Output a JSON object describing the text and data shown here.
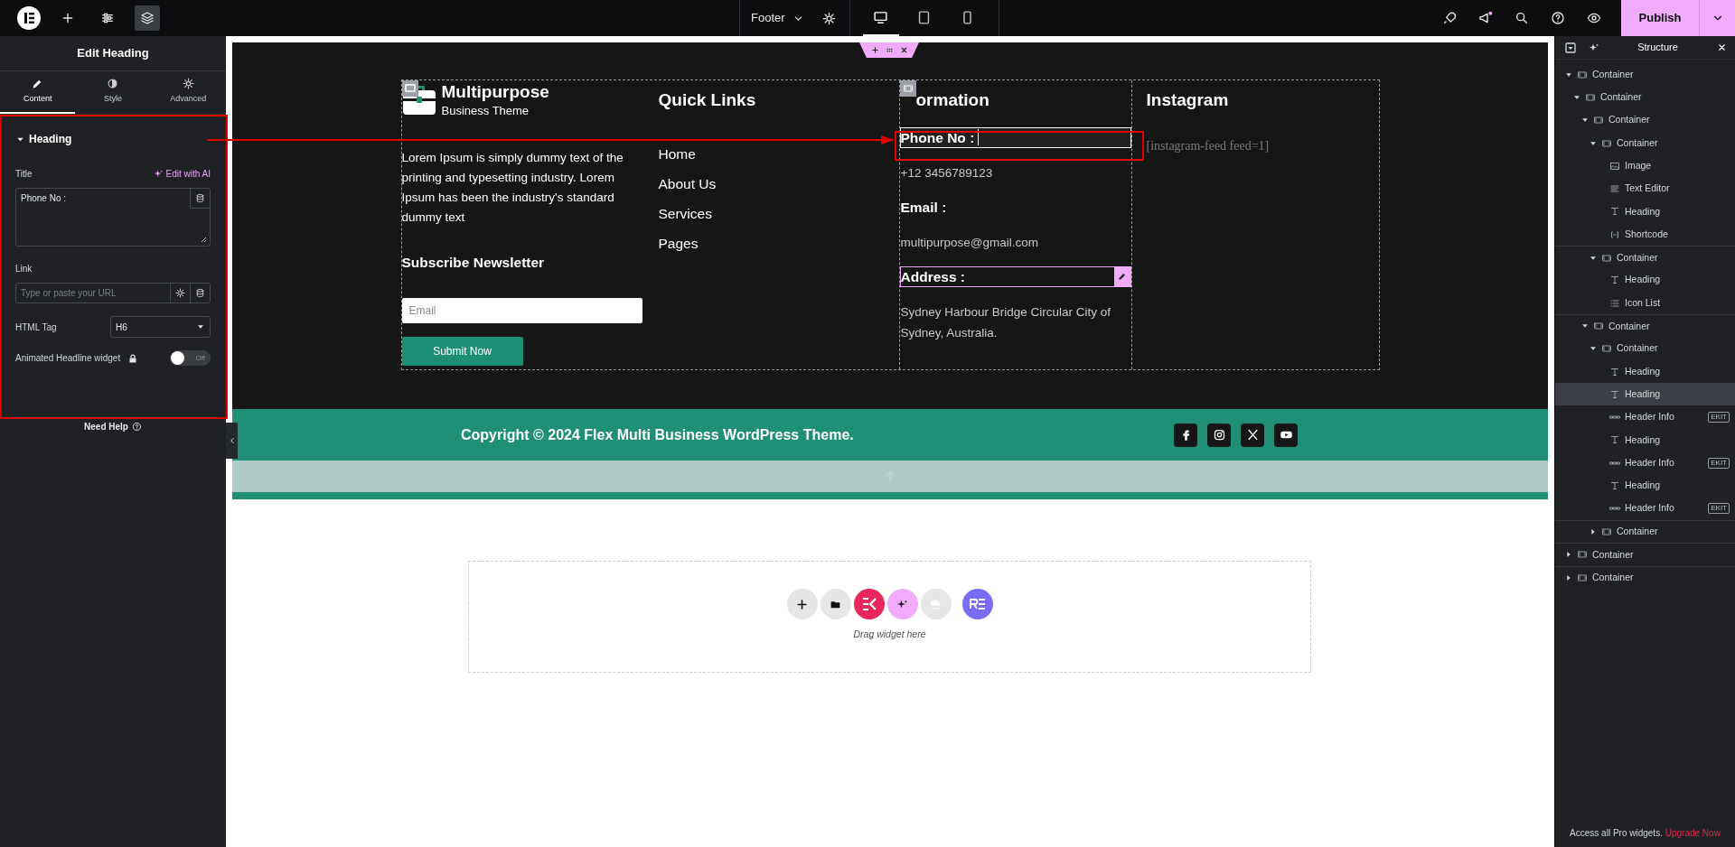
{
  "topbar": {
    "document": "Footer",
    "devices": [
      {
        "kind": "desktop",
        "selected": true
      },
      {
        "kind": "tablet",
        "selected": false
      },
      {
        "kind": "mobile",
        "selected": false
      }
    ],
    "publish": "Publish"
  },
  "panel": {
    "title": "Edit Heading",
    "tabs": [
      {
        "kind": "content",
        "label": "Content",
        "selected": true
      },
      {
        "kind": "style",
        "label": "Style",
        "selected": false
      },
      {
        "kind": "advanced",
        "label": "Advanced",
        "selected": false
      }
    ],
    "section": {
      "label": "Heading",
      "expanded": true
    },
    "fields": {
      "title_label": "Title",
      "ai_link": "Edit with AI",
      "title_value": "Phone No :",
      "link_label": "Link",
      "link_placeholder": "Type or paste your URL",
      "tag_label": "HTML Tag",
      "tag_value": "H6",
      "animated_label": "Animated Headline widget",
      "animated_toggle": {
        "on": false,
        "label": "Off"
      }
    },
    "help": "Need Help"
  },
  "canvas": {
    "brand": {
      "title": "Multipurpose",
      "subtitle": "Business Theme"
    },
    "about": "Lorem Ipsum is simply dummy text of the printing and typesetting industry. Lorem Ipsum has been the industry's standard dummy text",
    "newsletter": {
      "heading": "Subscribe Newsletter",
      "placeholder": "Email",
      "button": "Submit Now"
    },
    "quick_links": {
      "heading": "Quick Links",
      "links": [
        "Home",
        "About Us",
        "Services",
        "Pages"
      ]
    },
    "information": {
      "heading": "ormation",
      "items": [
        {
          "kind": "heading",
          "text": "Phone No :",
          "selected": true,
          "hovered": false
        },
        {
          "kind": "text",
          "text": "+12 3456789123",
          "selected": false,
          "hovered": false
        },
        {
          "kind": "heading",
          "text": "Email :",
          "selected": false,
          "hovered": false
        },
        {
          "kind": "text",
          "text": "multipurpose@gmail.com",
          "selected": false,
          "hovered": false
        },
        {
          "kind": "heading",
          "text": "Address :",
          "selected": false,
          "hovered": true
        },
        {
          "kind": "text",
          "text": "Sydney Harbour Bridge Circular City of Sydney, Australia.",
          "selected": false,
          "hovered": false
        }
      ]
    },
    "instagram": {
      "heading": "Instagram",
      "shortcode": "[instagram-feed feed=1]"
    },
    "copyright": "Copyright © 2024 Flex Multi Business WordPress Theme.",
    "socials": [
      {
        "kind": "facebook"
      },
      {
        "kind": "instagram"
      },
      {
        "kind": "x"
      },
      {
        "kind": "youtube"
      }
    ],
    "drop_zone": {
      "hint": "Drag widget here"
    }
  },
  "structure": {
    "title": "Structure",
    "tree": [
      {
        "kind": "container",
        "label": "Container",
        "expanded": true,
        "selected": false,
        "children": [
          {
            "kind": "container",
            "label": "Container",
            "expanded": true,
            "selected": false,
            "children": [
              {
                "kind": "container",
                "label": "Container",
                "expanded": true,
                "selected": false,
                "children": [
                  {
                    "kind": "container",
                    "label": "Container",
                    "expanded": true,
                    "selected": false,
                    "children": [
                      {
                        "kind": "image",
                        "label": "Image",
                        "selected": false
                      },
                      {
                        "kind": "text-editor",
                        "label": "Text Editor",
                        "selected": false
                      },
                      {
                        "kind": "heading",
                        "label": "Heading",
                        "selected": false
                      },
                      {
                        "kind": "shortcode",
                        "label": "Shortcode",
                        "selected": false
                      }
                    ]
                  },
                  {
                    "kind": "container",
                    "label": "Container",
                    "expanded": true,
                    "selected": false,
                    "children": [
                      {
                        "kind": "heading",
                        "label": "Heading",
                        "selected": false
                      },
                      {
                        "kind": "icon-list",
                        "label": "Icon List",
                        "selected": false
                      }
                    ]
                  }
                ]
              },
              {
                "kind": "container",
                "label": "Container",
                "expanded": true,
                "selected": false,
                "children": [
                  {
                    "kind": "container",
                    "label": "Container",
                    "expanded": true,
                    "selected": false,
                    "children": [
                      {
                        "kind": "heading",
                        "label": "Heading",
                        "selected": false
                      },
                      {
                        "kind": "heading",
                        "label": "Heading",
                        "selected": true
                      },
                      {
                        "kind": "header-info",
                        "label": "Header Info",
                        "selected": false,
                        "badge": "EKIT"
                      },
                      {
                        "kind": "heading",
                        "label": "Heading",
                        "selected": false
                      },
                      {
                        "kind": "header-info",
                        "label": "Header Info",
                        "selected": false,
                        "badge": "EKIT"
                      },
                      {
                        "kind": "heading",
                        "label": "Heading",
                        "selected": false
                      },
                      {
                        "kind": "header-info",
                        "label": "Header Info",
                        "selected": false,
                        "badge": "EKIT"
                      }
                    ]
                  },
                  {
                    "kind": "container",
                    "label": "Container",
                    "expanded": false,
                    "selected": false
                  }
                ]
              }
            ]
          }
        ]
      },
      {
        "kind": "container",
        "label": "Container",
        "expanded": false,
        "selected": false
      },
      {
        "kind": "container",
        "label": "Container",
        "expanded": false,
        "selected": false
      }
    ],
    "footer_text": "Access all Pro widgets.",
    "footer_link": "Upgrade Now"
  }
}
